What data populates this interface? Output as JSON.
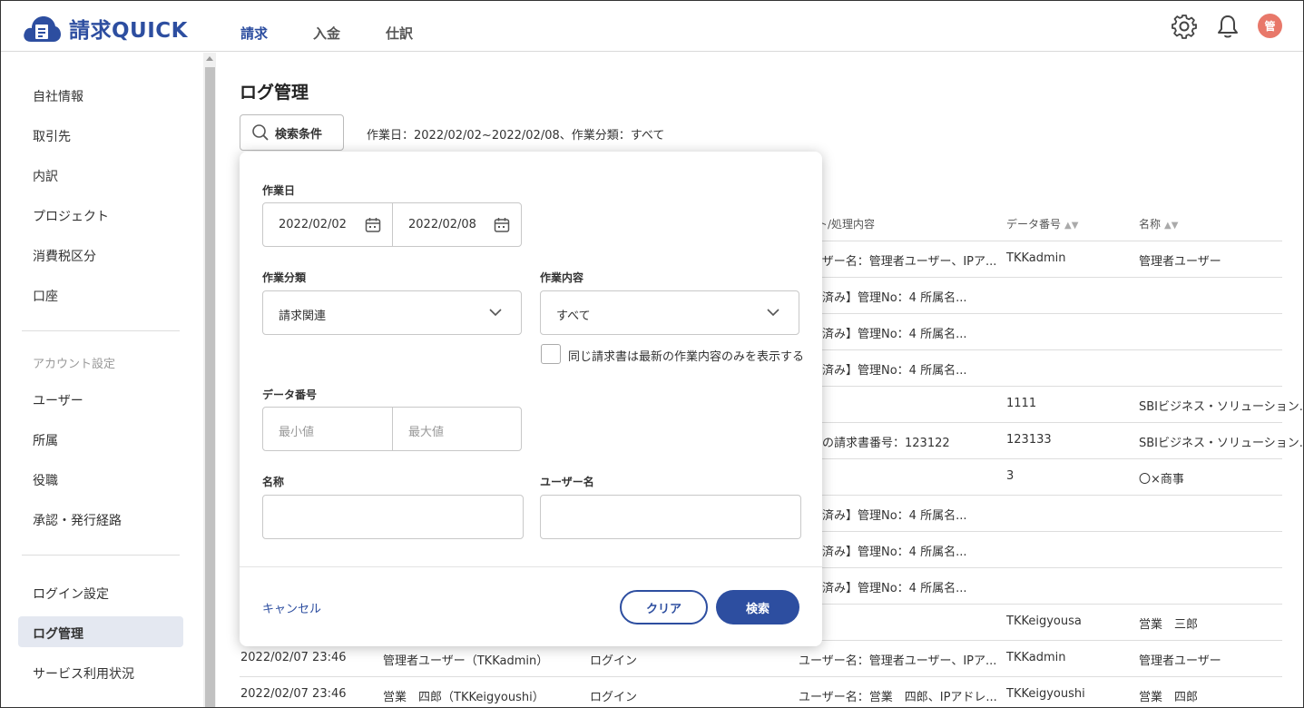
{
  "app": {
    "logo_text": "請求QUICK",
    "brand_color": "#2d4ea0"
  },
  "topnav": [
    "請求",
    "入金",
    "仕訳"
  ],
  "header": {
    "avatar_text": "管"
  },
  "sidebar": {
    "items1": [
      "自社情報",
      "取引先",
      "内訳",
      "プロジェクト",
      "消費税区分",
      "口座"
    ],
    "group_label": "アカウント設定",
    "items2": [
      "ユーザー",
      "所属",
      "役職",
      "承認・発行経路"
    ],
    "items3": [
      "ログイン設定",
      "ログ管理",
      "サービス利用状況"
    ]
  },
  "page": {
    "title": "ログ管理",
    "search_button": "検索条件",
    "condition_summary": "作業日：2022/02/02~2022/02/08、作業分類：すべて"
  },
  "table": {
    "headers": {
      "content": "ト/処理内容",
      "data_no": "データ番号",
      "name": "名称"
    },
    "rows": [
      {
        "content": "ーザー名：管理者ユーザー、IPア...",
        "data_no": "TKKadmin",
        "name": "管理者ユーザー"
      },
      {
        "content": "除済み】管理No：4 所属名...",
        "data_no": "",
        "name": ""
      },
      {
        "content": "除済み】管理No：4 所属名...",
        "data_no": "",
        "name": ""
      },
      {
        "content": "除済み】管理No：4 所属名...",
        "data_no": "",
        "name": ""
      },
      {
        "content": "",
        "data_no": "1111",
        "name": "SBIビジネス・ソリューション..."
      },
      {
        "content": "元の請求書番号：123122",
        "data_no": "123133",
        "name": "SBIビジネス・ソリューション..."
      },
      {
        "content": "",
        "data_no": "3",
        "name": "〇×商事"
      },
      {
        "content": "除済み】管理No：4 所属名...",
        "data_no": "",
        "name": ""
      },
      {
        "content": "除済み】管理No：4 所属名...",
        "data_no": "",
        "name": ""
      },
      {
        "content": "除済み】管理No：4 所属名...",
        "data_no": "",
        "name": ""
      },
      {
        "content": "",
        "data_no": "TKKeigyousa",
        "name": "営業　三郎"
      }
    ],
    "full_rows": [
      {
        "datetime": "2022/02/07 23:46",
        "user": "管理者ユーザー（TKKadmin）",
        "category": "ログイン",
        "content": "ユーザー名：管理者ユーザー、IPア...",
        "data_no": "TKKadmin",
        "name": "管理者ユーザー"
      },
      {
        "datetime": "2022/02/07 23:46",
        "user": "営業　四郎（TKKeigyoushi）",
        "category": "ログイン",
        "content": "ユーザー名：営業　四郎、IPアドレ...",
        "data_no": "TKKeigyoushi",
        "name": "営業　四郎"
      }
    ]
  },
  "dialog": {
    "work_date_label": "作業日",
    "date_from": "2022/02/02",
    "date_to": "2022/02/08",
    "category_label": "作業分類",
    "category_value": "請求関連",
    "content_label": "作業内容",
    "content_value": "すべて",
    "latest_only_label": "同じ請求書は最新の作業内容のみを表示する",
    "data_no_label": "データ番号",
    "min_placeholder": "最小値",
    "max_placeholder": "最大値",
    "name_label": "名称",
    "user_label": "ユーザー名",
    "cancel": "キャンセル",
    "clear": "クリア",
    "search": "検索"
  }
}
